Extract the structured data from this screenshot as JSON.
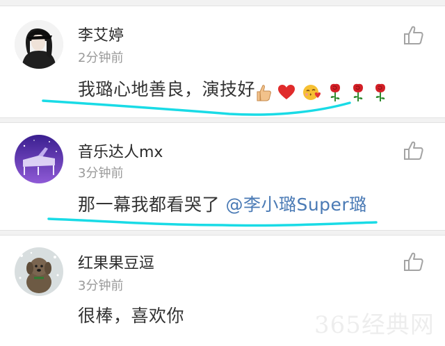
{
  "comments": [
    {
      "username": "李艾婷",
      "time": "2分钟前",
      "text": "我璐心地善良，演技好",
      "emojis": [
        "thumbs-up",
        "heart",
        "kiss-face",
        "rose",
        "rose",
        "rose"
      ],
      "avatar": "woman-with-cap-avatar"
    },
    {
      "username": "音乐达人mx",
      "time": "3分钟前",
      "text": "那一幕我都看哭了 ",
      "mention": "@李小璐Super璐",
      "avatar": "piano-avatar"
    },
    {
      "username": "红果果豆逗",
      "time": "3分钟前",
      "text": "很棒，喜欢你",
      "avatar": "dog-avatar"
    }
  ],
  "colors": {
    "highlight_stroke": "#19dbe6",
    "mention": "#4a7ab5",
    "username": "#2a2a2a",
    "time": "#9a9a9a",
    "like_icon": "#a3a3a3"
  },
  "icons": {
    "like": "thumbs-up-outline-icon"
  },
  "watermark": "365经典网"
}
